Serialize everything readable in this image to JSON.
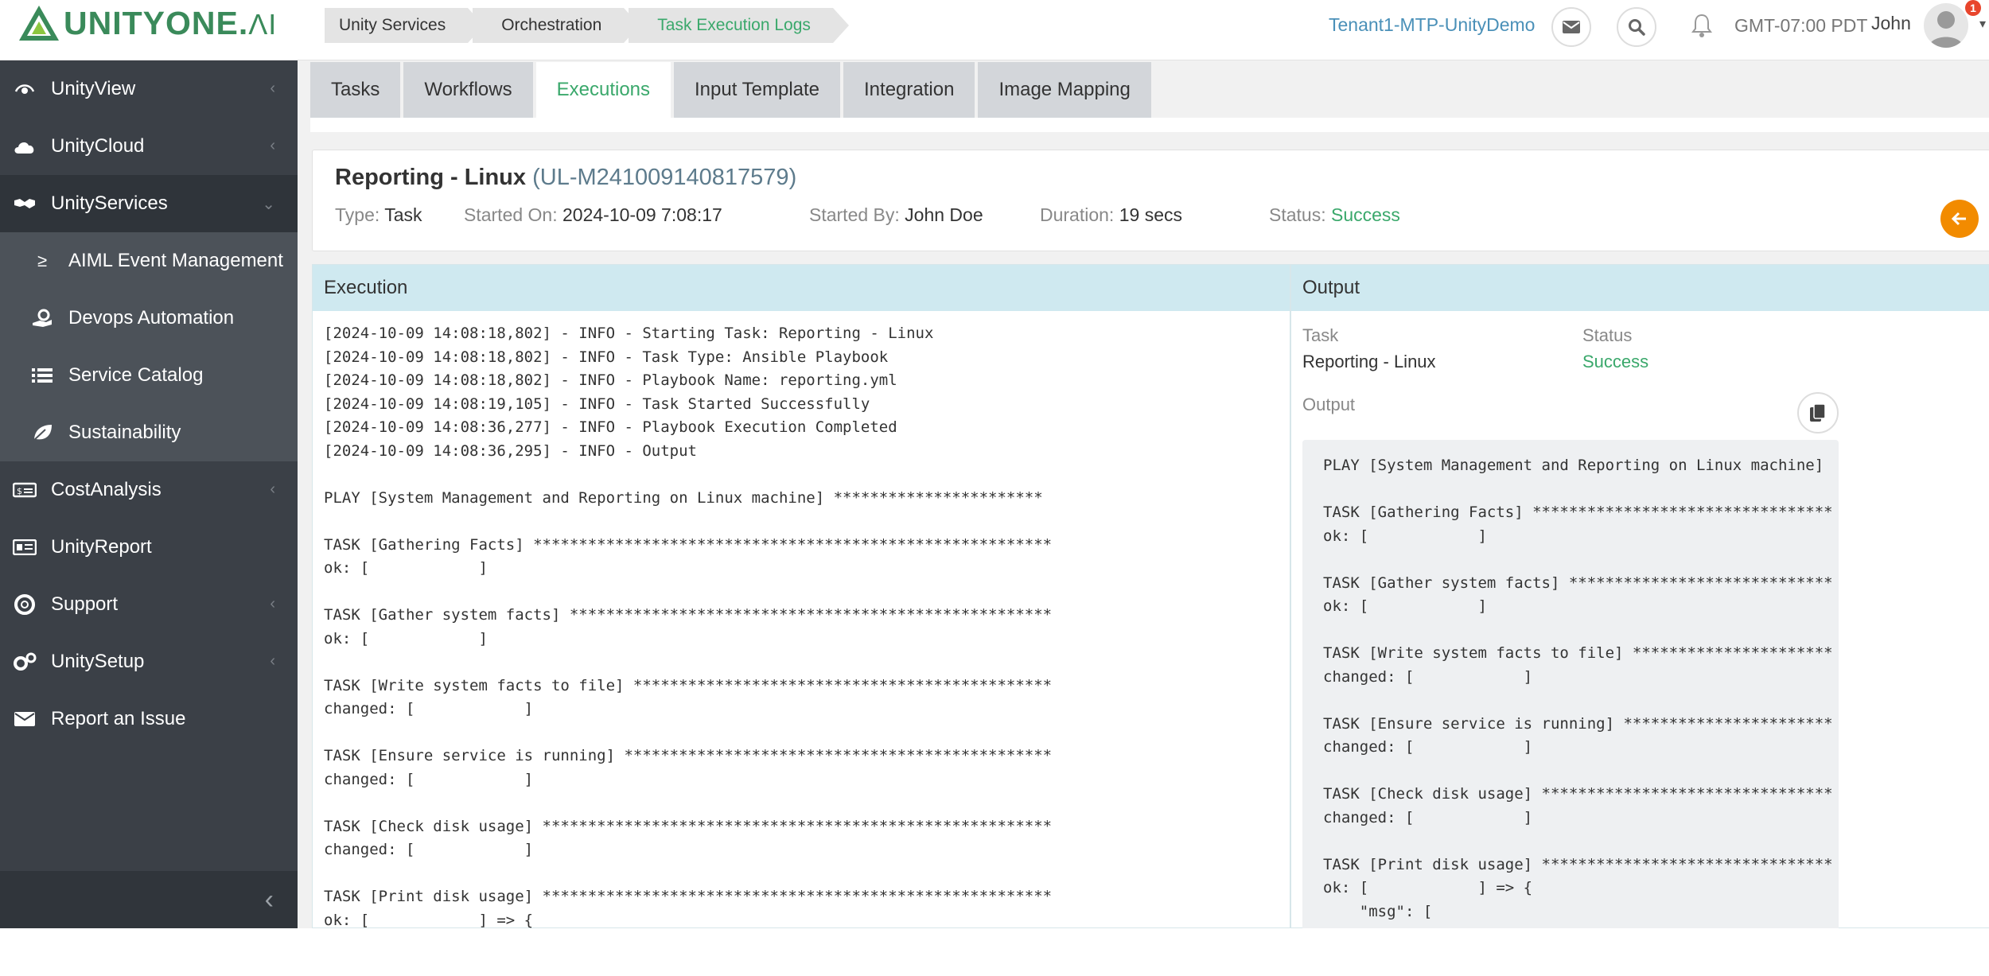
{
  "app": {
    "logo_text": "UNITYONE.",
    "logo_suffix": "ΛI"
  },
  "breadcrumb": [
    "Unity Services",
    "Orchestration",
    "Task Execution Logs"
  ],
  "header": {
    "tenant": "Tenant1-MTP-UnityDemo",
    "timezone": "GMT-07:00 PDT",
    "user": "John",
    "badge_count": "1"
  },
  "sidebar": {
    "items": [
      {
        "label": "UnityView",
        "icon": "eye-icon"
      },
      {
        "label": "UnityCloud",
        "icon": "cloud-icon"
      },
      {
        "label": "UnityServices",
        "icon": "handshake-icon"
      },
      {
        "label": "CostAnalysis",
        "icon": "money-icon"
      },
      {
        "label": "UnityReport",
        "icon": "report-icon"
      },
      {
        "label": "Support",
        "icon": "lifebuoy-icon"
      },
      {
        "label": "UnitySetup",
        "icon": "cogs-icon"
      },
      {
        "label": "Report an Issue",
        "icon": "envelope-icon"
      }
    ],
    "subitems": [
      {
        "label": "AIML Event Management",
        "icon": "chart-icon"
      },
      {
        "label": "Devops Automation",
        "icon": "hand-cog-icon"
      },
      {
        "label": "Service Catalog",
        "icon": "list-icon"
      },
      {
        "label": "Sustainability",
        "icon": "leaf-icon"
      }
    ]
  },
  "tabs": [
    "Tasks",
    "Workflows",
    "Executions",
    "Input Template",
    "Integration",
    "Image Mapping"
  ],
  "job": {
    "name": "Reporting - Linux",
    "id": "(UL-M241009140817579)",
    "type_label": "Type:",
    "type": "Task",
    "started_on_label": "Started On:",
    "started_on": "2024-10-09 7:08:17",
    "started_by_label": "Started By:",
    "started_by": "John Doe",
    "duration_label": "Duration:",
    "duration": "19 secs",
    "status_label": "Status:",
    "status": "Success"
  },
  "execution": {
    "header": "Execution",
    "log": "[2024-10-09 14:08:18,802] - INFO - Starting Task: Reporting - Linux\n[2024-10-09 14:08:18,802] - INFO - Task Type: Ansible Playbook\n[2024-10-09 14:08:18,802] - INFO - Playbook Name: reporting.yml\n[2024-10-09 14:08:19,105] - INFO - Task Started Successfully\n[2024-10-09 14:08:36,277] - INFO - Playbook Execution Completed\n[2024-10-09 14:08:36,295] - INFO - Output\n\nPLAY [System Management and Reporting on Linux machine] ***********************\n\nTASK [Gathering Facts] *********************************************************\nok: [            ]\n\nTASK [Gather system facts] *****************************************************\nok: [            ]\n\nTASK [Write system facts to file] **********************************************\nchanged: [            ]\n\nTASK [Ensure service is running] ***********************************************\nchanged: [            ]\n\nTASK [Check disk usage] ********************************************************\nchanged: [            ]\n\nTASK [Print disk usage] ********************************************************\nok: [            ] => {"
  },
  "output": {
    "header": "Output",
    "task_label": "Task",
    "task_value": "Reporting - Linux",
    "status_label": "Status",
    "status_value": "Success",
    "output_label": "Output",
    "text": "PLAY [System Management and Reporting on Linux machine]\n\nTASK [Gathering Facts] *********************************\nok: [            ]\n\nTASK [Gather system facts] *****************************\nok: [            ]\n\nTASK [Write system facts to file] **********************\nchanged: [            ]\n\nTASK [Ensure service is running] ***********************\nchanged: [            ]\n\nTASK [Check disk usage] ********************************\nchanged: [            ]\n\nTASK [Print disk usage] ********************************\nok: [            ] => {\n    \"msg\": ["
  },
  "colors": {
    "accent_green": "#3aa86b",
    "sidebar_bg": "#3b4047",
    "panel_header": "#cfe9f0",
    "back_button": "#f28b00"
  }
}
